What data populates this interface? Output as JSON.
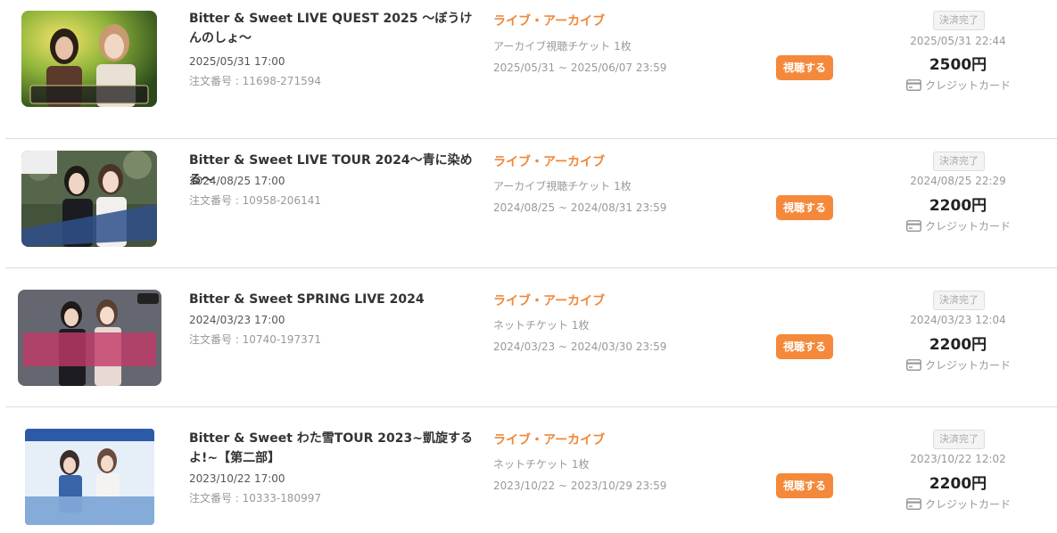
{
  "colors": {
    "accent": "#f5893b",
    "category": "#f0883a",
    "badge_bg": "#f4f4f4"
  },
  "orders": [
    {
      "thumbnail_text": "Bitter & Sweet LIVE QUEST 2025 〜ぼうけんのしょ〜",
      "title": "Bitter & Sweet LIVE QUEST 2025 〜ぼうけんのしょ〜",
      "datetime": "2025/05/31 17:00",
      "order_number": "注文番号 : 11698-271594",
      "category": "ライブ・アーカイブ",
      "ticket": "アーカイブ視聴チケット 1枚",
      "period": "2025/05/31 ~ 2025/06/07 23:59",
      "watch_label": "視聴する",
      "status": "決済完了",
      "paid_at": "2025/05/31 22:44",
      "price": "2500円",
      "payment_method": "クレジットカード"
    },
    {
      "thumbnail_text": "Bitter & Sweet LIVE TOUR 2024 〜青に染める〜",
      "title": "Bitter & Sweet LIVE TOUR 2024〜青に染める〜",
      "datetime": "2024/08/25 17:00",
      "order_number": "注文番号 : 10958-206141",
      "category": "ライブ・アーカイブ",
      "ticket": "アーカイブ視聴チケット 1枚",
      "period": "2024/08/25 ~ 2024/08/31 23:59",
      "watch_label": "視聴する",
      "status": "決済完了",
      "paid_at": "2024/08/25 22:29",
      "price": "2200円",
      "payment_method": "クレジットカード"
    },
    {
      "thumbnail_text": "Bitter & Sweet SPRING LIVE 2024",
      "title": "Bitter & Sweet SPRING LIVE 2024",
      "datetime": "2024/03/23 17:00",
      "order_number": "注文番号 : 10740-197371",
      "category": "ライブ・アーカイブ",
      "ticket": "ネットチケット 1枚",
      "period": "2024/03/23 ~ 2024/03/30 23:59",
      "watch_label": "視聴する",
      "status": "決済完了",
      "paid_at": "2024/03/23 12:04",
      "price": "2200円",
      "payment_method": "クレジットカード"
    },
    {
      "thumbnail_text": "第二部 OPEN 16:30 / START 17:00 Bitter & Sweet わた雪TOUR 2023〜凱旋するよ！〜",
      "title": "Bitter & Sweet わた雪TOUR 2023~凱旋するよ!~【第二部】",
      "datetime": "2023/10/22 17:00",
      "order_number": "注文番号 : 10333-180997",
      "category": "ライブ・アーカイブ",
      "ticket": "ネットチケット 1枚",
      "period": "2023/10/22 ~ 2023/10/29 23:59",
      "watch_label": "視聴する",
      "status": "決済完了",
      "paid_at": "2023/10/22 12:02",
      "price": "2200円",
      "payment_method": "クレジットカード"
    }
  ]
}
